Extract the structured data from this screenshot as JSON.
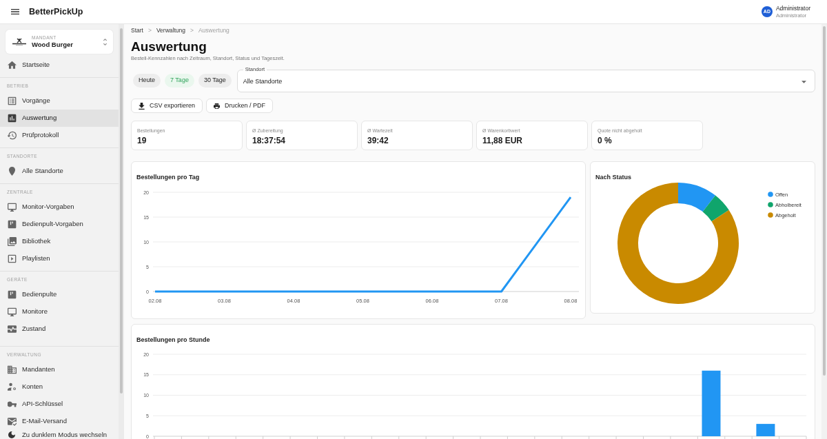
{
  "app_bar": {
    "title": "BetterPickUp",
    "user": {
      "initials": "AD",
      "name": "Administrator",
      "role": "Administrator"
    }
  },
  "sidebar": {
    "tenant": {
      "label": "MANDANT",
      "name": "Wood Burger"
    },
    "home": {
      "label": "Startseite",
      "selected": false
    },
    "sections": [
      {
        "title": "BETRIEB",
        "items": [
          {
            "label": "Vorgänge",
            "selected": false
          },
          {
            "label": "Auswertung",
            "selected": true
          },
          {
            "label": "Prüfprotokoll",
            "selected": false
          }
        ]
      },
      {
        "title": "STANDORTE",
        "items": [
          {
            "label": "Alle Standorte",
            "selected": false
          }
        ]
      },
      {
        "title": "ZENTRALE",
        "items": [
          {
            "label": "Monitor-Vorgaben",
            "selected": false
          },
          {
            "label": "Bedienpult-Vorgaben",
            "selected": false
          },
          {
            "label": "Bibliothek",
            "selected": false
          },
          {
            "label": "Playlisten",
            "selected": false
          }
        ]
      },
      {
        "title": "GERÄTE",
        "items": [
          {
            "label": "Bedienpulte",
            "selected": false
          },
          {
            "label": "Monitore",
            "selected": false
          },
          {
            "label": "Zustand",
            "selected": false
          }
        ]
      },
      {
        "title": "VERWALTUNG",
        "items": [
          {
            "label": "Mandanten",
            "selected": false
          },
          {
            "label": "Konten",
            "selected": false
          },
          {
            "label": "API-Schlüssel",
            "selected": false
          },
          {
            "label": "E-Mail-Versand",
            "selected": false
          }
        ]
      }
    ],
    "theme_toggle": {
      "label": "Zu dunklem Modus wechseln"
    }
  },
  "breadcrumb": {
    "items": [
      {
        "label": "Start",
        "current": false
      },
      {
        "label": "Verwaltung",
        "current": false
      },
      {
        "label": "Auswertung",
        "current": true
      }
    ],
    "separators": [
      ">",
      ">"
    ]
  },
  "page": {
    "title": "Auswertung",
    "subtitle": "Bestell-Kennzahlen nach Zeitraum, Standort, Status und Tageszeit."
  },
  "period_filters": [
    {
      "label": "Heute",
      "selected": false
    },
    {
      "label": "7 Tage",
      "selected": true
    },
    {
      "label": "30 Tage",
      "selected": false
    }
  ],
  "location_select": {
    "label": "Standort",
    "value": "Alle Standorte"
  },
  "actions": [
    {
      "label": "CSV exportieren"
    },
    {
      "label": "Drucken / PDF"
    }
  ],
  "kpis": [
    {
      "label": "Bestellungen",
      "value": "19"
    },
    {
      "label": "Ø Zubereitung",
      "value": "18:37:54"
    },
    {
      "label": "Ø Wartezeit",
      "value": "39:42"
    },
    {
      "label": "Ø Warenkorbwert",
      "value": "11,88 EUR"
    },
    {
      "label": "Quote nicht abgeholt",
      "value": "0 %"
    }
  ],
  "daily_chart": {
    "title": "Bestellungen pro Tag",
    "chart_data": {
      "type": "line",
      "categories": [
        "02.08",
        "03.08",
        "04.08",
        "05.08",
        "06.08",
        "07.08",
        "08.08"
      ],
      "values": [
        0,
        0,
        0,
        0,
        0,
        0,
        19
      ],
      "yticks": [
        0,
        5,
        10,
        15,
        20
      ],
      "ylim": [
        0,
        20
      ],
      "grid": true
    }
  },
  "status_chart": {
    "title": "Nach Status",
    "legend": [
      {
        "label": "Offen",
        "color": "#2196f3"
      },
      {
        "label": "Abholbereit",
        "color": "#10a56c"
      },
      {
        "label": "Abgeholt",
        "color": "#c98a00"
      }
    ]
  },
  "hourly_chart": {
    "title": "Bestellungen pro Stunde",
    "chart_data": {
      "type": "bar",
      "values": [
        0,
        0,
        0,
        0,
        0,
        0,
        0,
        0,
        0,
        0,
        0,
        0,
        0,
        0,
        0,
        0,
        0,
        0,
        0,
        0,
        16,
        0,
        3,
        0
      ],
      "yticks": [
        0,
        5,
        10,
        15,
        20
      ],
      "ylim": [
        0,
        20
      ],
      "grid": true
    }
  }
}
